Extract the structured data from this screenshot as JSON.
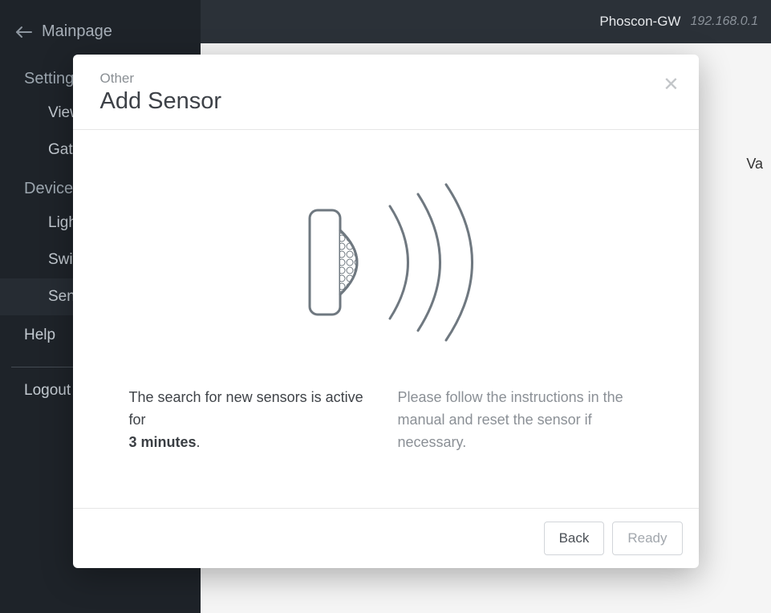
{
  "topbar": {
    "gateway_name": "Phoscon-GW",
    "gateway_ip": "192.168.0.1"
  },
  "sidebar": {
    "back_label": "Mainpage",
    "settings_header": "Settings",
    "settings_items": [
      {
        "label": "View"
      },
      {
        "label": "Gateway"
      }
    ],
    "devices_header": "Devices",
    "devices_items": [
      {
        "label": "Lights"
      },
      {
        "label": "Switches"
      },
      {
        "label": "Sensors",
        "active": true
      }
    ],
    "help_label": "Help",
    "logout_label": "Logout"
  },
  "content": {
    "val_column": "Va"
  },
  "modal": {
    "category": "Other",
    "title": "Add Sensor",
    "search_text": "The search for new sensors is active for",
    "search_time": "3 minutes",
    "instructions": "Please follow the instructions in the manual and reset the sensor if necessary.",
    "back_button": "Back",
    "ready_button": "Ready"
  }
}
